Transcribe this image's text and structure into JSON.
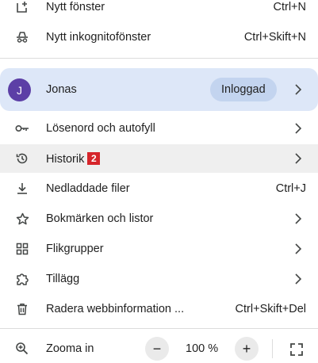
{
  "menu": {
    "new_window": {
      "label": "Nytt fönster",
      "shortcut": "Ctrl+N",
      "icon": "new-window-icon"
    },
    "new_incognito": {
      "label": "Nytt inkognitofönster",
      "shortcut": "Ctrl+Skift+N",
      "icon": "incognito-icon"
    },
    "profile": {
      "avatar_letter": "J",
      "name": "Jonas",
      "status": "Inloggad",
      "avatar_color": "#5c3fa6"
    },
    "passwords": {
      "label": "Lösenord och autofyll",
      "icon": "key-icon"
    },
    "history": {
      "label": "Historik",
      "badge": "2",
      "icon": "history-icon"
    },
    "downloads": {
      "label": "Nedladdade filer",
      "shortcut": "Ctrl+J",
      "icon": "download-icon"
    },
    "bookmarks": {
      "label": "Bokmärken och listor",
      "icon": "star-icon"
    },
    "tab_groups": {
      "label": "Flikgrupper",
      "icon": "tab-groups-icon"
    },
    "extensions": {
      "label": "Tillägg",
      "icon": "puzzle-icon"
    },
    "clear_data": {
      "label": "Radera webbinformation ...",
      "shortcut": "Ctrl+Skift+Del",
      "icon": "trash-icon"
    },
    "zoom": {
      "label": "Zooma in",
      "value": "100 %",
      "minus": "−",
      "plus": "+",
      "icon": "zoom-in-icon"
    }
  },
  "colors": {
    "accent_bg": "#dde7f8",
    "pill_bg": "#c3d4ef",
    "badge": "#d6252b",
    "hover": "#efefef"
  }
}
